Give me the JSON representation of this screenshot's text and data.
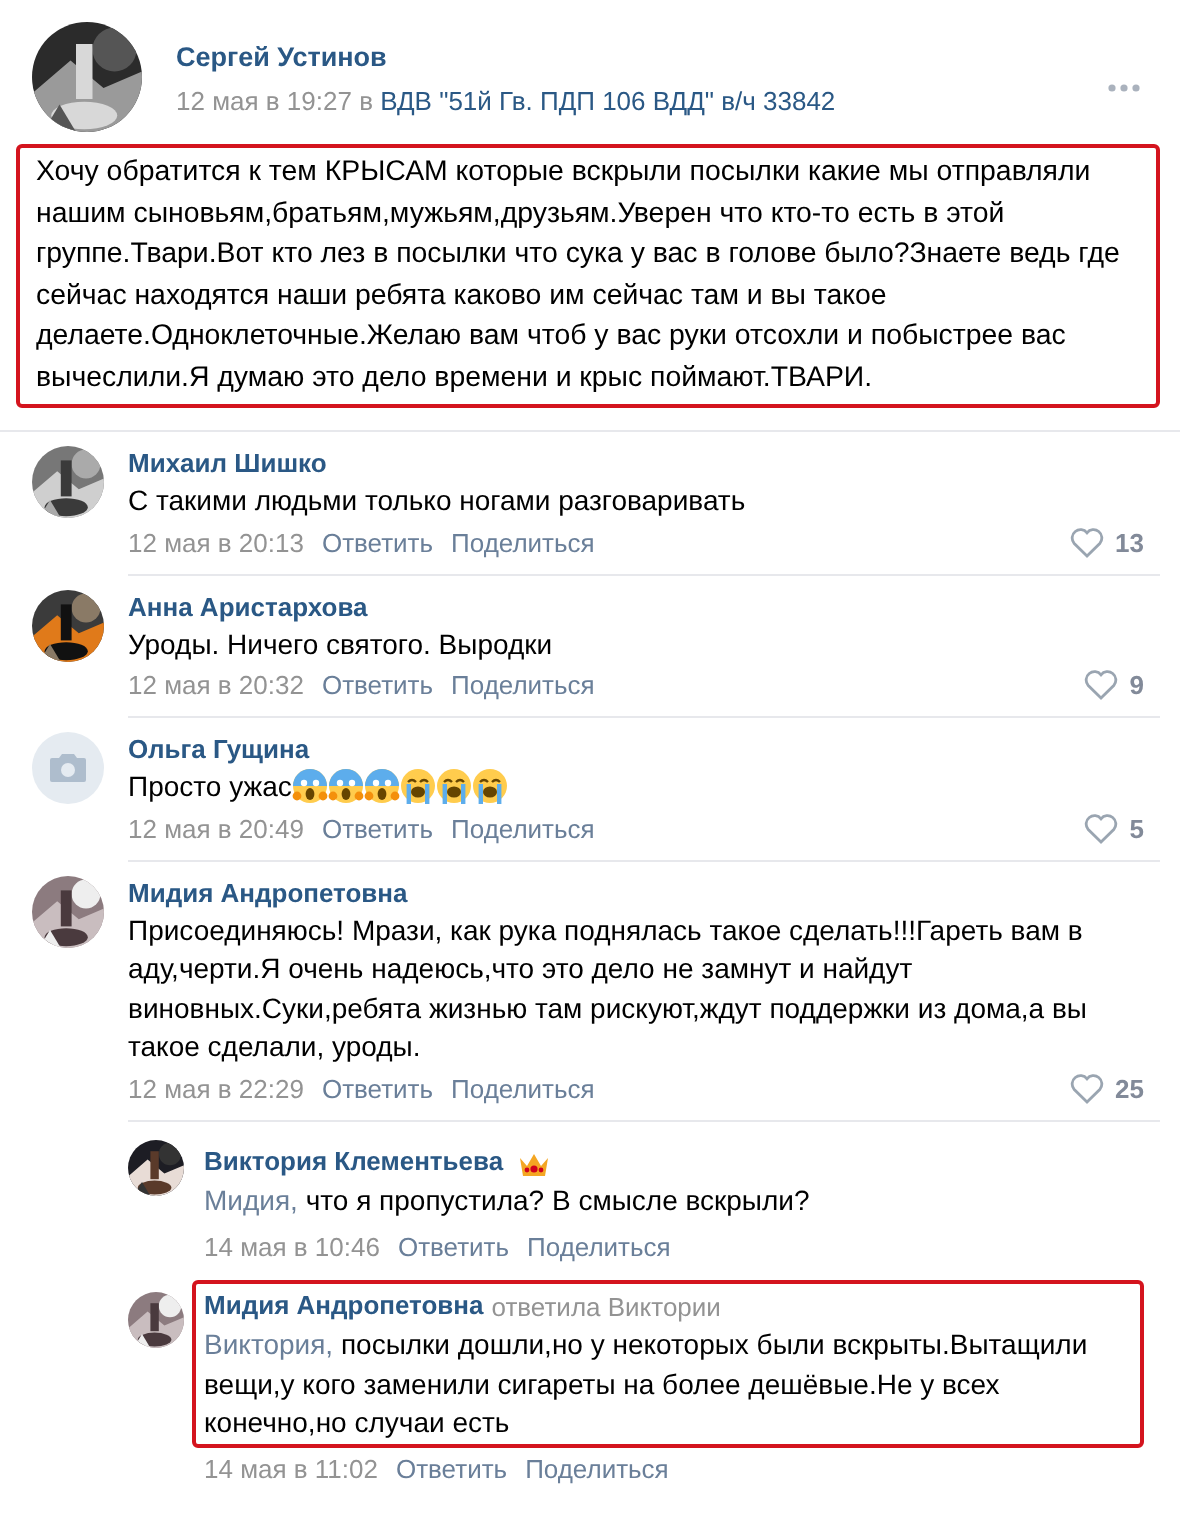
{
  "post": {
    "author": "Сергей Устинов",
    "date": "12 мая в 19:27",
    "preposition": "в",
    "group": "ВДВ \"51й Гв. ПДП 106 ВДД\" в/ч 33842",
    "text": "Хочу обратится к тем КРЫСАМ которые вскрыли посылки какие мы отправляли нашим сыновьям,братьям,мужьям,друзьям.Уверен что кто-то есть в этой группе.Твари.Вот кто лез в посылки что сука у вас в голове было?Знаете ведь где сейчас находятся наши ребята каково им сейчас там и вы такое делаете.Одноклеточные.Желаю вам чтоб у вас руки отсохли и побыстрее вас вычеслили.Я думаю это дело времени и крыс поймают.ТВАРИ.",
    "highlighted": true
  },
  "comments": [
    {
      "author": "Михаил Шишко",
      "text": "С такими людьми только ногами разговаривать",
      "date": "12 мая в 20:13",
      "reply": "Ответить",
      "share": "Поделиться",
      "likes": "13"
    },
    {
      "author": "Анна Аристархова",
      "text": "Уроды. Ничего святого. Выродки",
      "date": "12 мая в 20:32",
      "reply": "Ответить",
      "share": "Поделиться",
      "likes": "9"
    },
    {
      "author": "Ольга Гущина",
      "avatar": {
        "kind": "camera"
      },
      "text": "Просто ужас",
      "emoji": [
        {
          "kind": "scream"
        },
        {
          "kind": "scream"
        },
        {
          "kind": "scream"
        },
        {
          "kind": "sob"
        },
        {
          "kind": "sob"
        },
        {
          "kind": "sob"
        }
      ],
      "date": "12 мая в 20:49",
      "reply": "Ответить",
      "share": "Поделиться",
      "likes": "5"
    },
    {
      "author": "Мидия Андропетовна",
      "text": "Присоединяюсь! Мрази, как рука поднялась такое сделать!!!Гареть вам в аду,черти.Я очень надеюсь,что это дело не замнут и найдут виновных.Суки,ребята жизнью там рискуют,ждут поддержки из дома,а вы такое сделали, уроды.",
      "date": "12 мая в 22:29",
      "reply": "Ответить",
      "share": "Поделиться",
      "likes": "25",
      "replies": [
        {
          "author": "Виктория Клементьева",
          "crown": true,
          "mention": "Мидия,",
          "text": " что я пропустила? В смысле вскрыли?",
          "date": "14 мая в 10:46",
          "reply": "Ответить",
          "share": "Поделиться",
          "highlighted": false
        },
        {
          "author": "Мидия Андропетовна",
          "reply_to": "ответила Виктории",
          "crown": false,
          "mention": "Виктория,",
          "text": " посылки дошли,но у некоторых были вскрыты.Вытащили вещи,у кого заменили сигареты на более дешёвые.Не у всех конечно,но случаи есть",
          "date": "14 мая в 11:02",
          "reply": "Ответить",
          "share": "Поделиться",
          "highlighted": true
        }
      ]
    }
  ]
}
